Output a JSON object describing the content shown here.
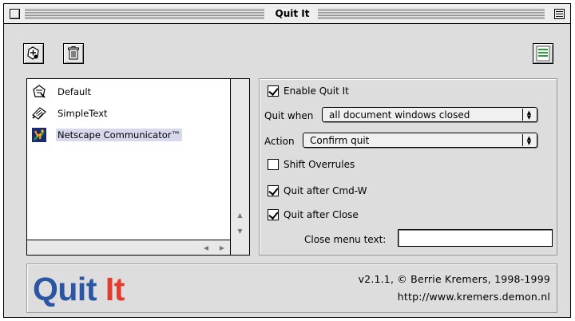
{
  "window": {
    "title": "Quit It"
  },
  "toolbar": {
    "add_icon": "add-application-icon",
    "delete_icon": "trash-icon",
    "right_icon": "list-window-icon"
  },
  "app_list": {
    "items": [
      {
        "label": "Default",
        "icon": "default-application-icon",
        "selected": false
      },
      {
        "label": "SimpleText",
        "icon": "simpletext-icon",
        "selected": false
      },
      {
        "label": "Netscape Communicator™",
        "icon": "netscape-icon",
        "selected": true
      }
    ],
    "selection_color": "#d6d9ee"
  },
  "settings": {
    "enable_label": "Enable Quit It",
    "enable_checked": true,
    "quit_when_label": "Quit when",
    "quit_when_value": "all document windows closed",
    "action_label": "Action",
    "action_value": "Confirm quit",
    "shift_label": "Shift Overrules",
    "shift_checked": false,
    "cmdw_label": "Quit after Cmd-W",
    "cmdw_checked": true,
    "close_label": "Quit after Close",
    "close_checked": true,
    "close_menu_label": "Close menu text:",
    "close_menu_value": ""
  },
  "footer": {
    "logo_quit": "Quit",
    "logo_it": "It",
    "version_line": "v2.1.1, © Berrie Kremers, 1998-1999",
    "url_line": "http://www.kremers.demon.nl",
    "logo_quit_color": "#2b56a3",
    "logo_it_color": "#e23b2f"
  }
}
